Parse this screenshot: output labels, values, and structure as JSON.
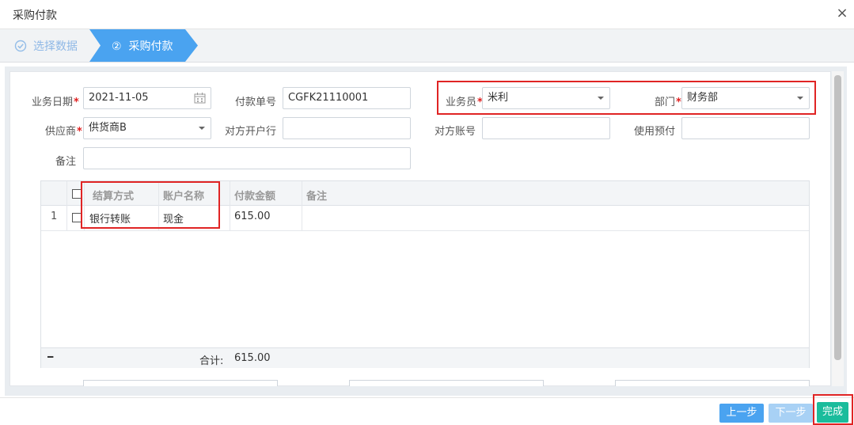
{
  "dialog": {
    "title": "采购付款",
    "close_glyph": "×"
  },
  "steps": [
    {
      "number": "",
      "label": "选择数据",
      "state": "done"
    },
    {
      "number": "②",
      "label": "采购付款",
      "state": "active"
    }
  ],
  "form": {
    "date": {
      "label": "业务日期",
      "value": "2021-11-05",
      "required": "*"
    },
    "payment_no": {
      "label": "付款单号",
      "value": "CGFK21110001"
    },
    "salesperson": {
      "label": "业务员",
      "value": "米利",
      "required": "*"
    },
    "department": {
      "label": "部门",
      "value": "财务部",
      "required": "*"
    },
    "supplier": {
      "label": "供应商",
      "value": "供货商B",
      "required": "*"
    },
    "counterparty_bank": {
      "label": "对方开户行",
      "value": ""
    },
    "counterparty_account": {
      "label": "对方账号",
      "value": ""
    },
    "use_prepayment": {
      "label": "使用预付",
      "value": ""
    },
    "remark": {
      "label": "备注",
      "value": ""
    }
  },
  "grid": {
    "columns": [
      "结算方式",
      "账户名称",
      "付款金额",
      "备注"
    ],
    "rows": [
      {
        "index": "1",
        "settle_method": "银行转账",
        "account_name": "现金",
        "amount": "615.00",
        "remark": ""
      }
    ],
    "footer": {
      "collapse_glyph": "━",
      "total_label": "合计:",
      "total_value": "615.00"
    }
  },
  "buttons": {
    "prev": "上一步",
    "next": "下一步",
    "finish": "完成"
  },
  "colors": {
    "accent": "#4aa3f0",
    "finish": "#1abc9c",
    "annotation": "#e02424"
  }
}
